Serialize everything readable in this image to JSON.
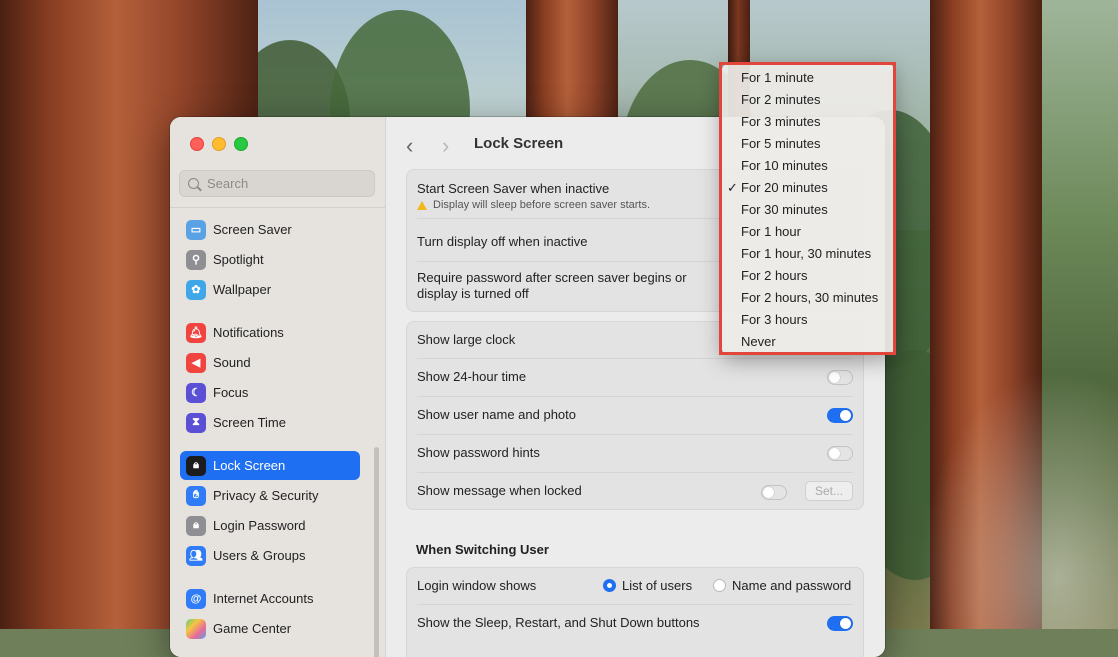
{
  "sidebar": {
    "search_placeholder": "Search",
    "items": [
      {
        "label": "Screen Saver",
        "icon": "screen-saver-icon",
        "color": "#5aa2e6"
      },
      {
        "label": "Spotlight",
        "icon": "spotlight-icon",
        "color": "#8e8e93"
      },
      {
        "label": "Wallpaper",
        "icon": "wallpaper-icon",
        "color": "#3fa7e8"
      },
      {
        "label": "Notifications",
        "icon": "notifications-icon",
        "color": "#f0443e"
      },
      {
        "label": "Sound",
        "icon": "sound-icon",
        "color": "#f0443e"
      },
      {
        "label": "Focus",
        "icon": "focus-icon",
        "color": "#5b4fd6"
      },
      {
        "label": "Screen Time",
        "icon": "screen-time-icon",
        "color": "#5b4fd6"
      },
      {
        "label": "Lock Screen",
        "icon": "lock-icon",
        "color": "#1c1c1e"
      },
      {
        "label": "Privacy & Security",
        "icon": "hand-icon",
        "color": "#2f7cf6"
      },
      {
        "label": "Login Password",
        "icon": "login-password-icon",
        "color": "#8e8e93"
      },
      {
        "label": "Users & Groups",
        "icon": "users-icon",
        "color": "#2f7cf6"
      },
      {
        "label": "Internet Accounts",
        "icon": "at-icon",
        "color": "#2f7cf6"
      },
      {
        "label": "Game Center",
        "icon": "game-center-icon",
        "color": "#e9e9e9"
      }
    ],
    "active": "Lock Screen"
  },
  "header": {
    "title": "Lock Screen"
  },
  "settings": {
    "screen_saver": {
      "label": "Start Screen Saver when inactive",
      "warning": "Display will sleep before screen saver starts."
    },
    "display_off": {
      "label": "Turn display off when inactive"
    },
    "require_password": {
      "label_line1": "Require password after screen saver begins or",
      "label_line2": "display is turned off"
    },
    "large_clock": {
      "label": "Show large clock"
    },
    "hour24": {
      "label": "Show 24-hour time",
      "on": false
    },
    "user_name_photo": {
      "label": "Show user name and photo",
      "on": true
    },
    "password_hints": {
      "label": "Show password hints",
      "on": false
    },
    "message_locked": {
      "label": "Show message when locked",
      "on": false,
      "button": "Set..."
    }
  },
  "switching_user": {
    "heading": "When Switching User",
    "login_window": {
      "label": "Login window shows",
      "option1": "List of users",
      "option2": "Name and password",
      "selected": "List of users"
    },
    "sleep_buttons": {
      "label": "Show the Sleep, Restart, and Shut Down buttons",
      "on": true
    }
  },
  "menu": {
    "selected": "For 20 minutes",
    "options": [
      "For 1 minute",
      "For 2 minutes",
      "For 3 minutes",
      "For 5 minutes",
      "For 10 minutes",
      "For 20 minutes",
      "For 30 minutes",
      "For 1 hour",
      "For 1 hour, 30 minutes",
      "For 2 hours",
      "For 2 hours, 30 minutes",
      "For 3 hours",
      "Never"
    ],
    "check_mark": "✓",
    "highlight_color": "#e2453c"
  },
  "icons": {
    "back": "‹",
    "forward": "›"
  }
}
